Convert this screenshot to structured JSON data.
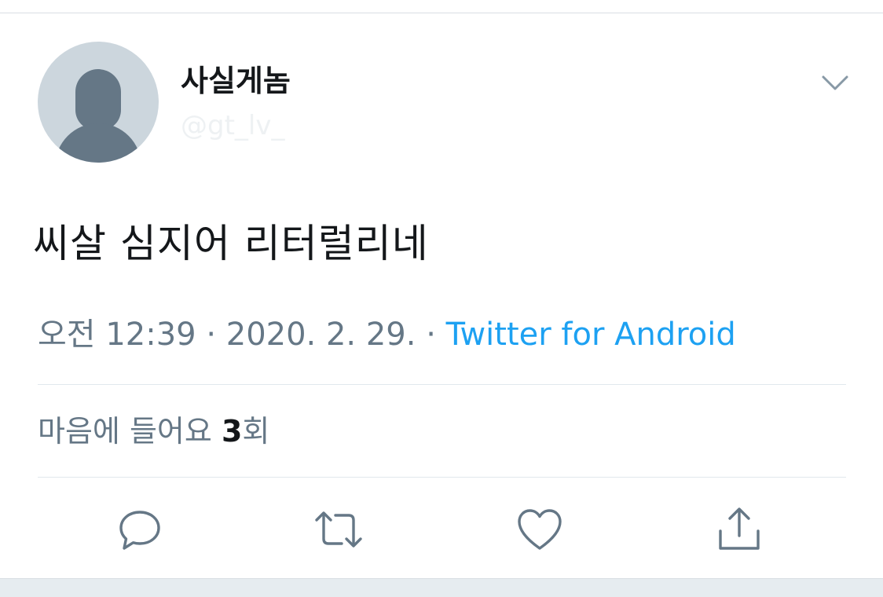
{
  "author": {
    "display_name": "사실게놈",
    "handle": "@gt_lv_"
  },
  "tweet": {
    "text": "씨살 심지어 리터럴리네",
    "time": "오전 12:39",
    "separator": "·",
    "date": "2020. 2. 29.",
    "source": "Twitter for Android"
  },
  "likes": {
    "label": "마음에 들어요",
    "count": "3",
    "suffix": "회"
  },
  "icons": {
    "menu": "chevron-down-icon",
    "reply": "reply-icon",
    "retweet": "retweet-icon",
    "like": "heart-icon",
    "share": "share-icon"
  },
  "colors": {
    "link": "#1da1f2",
    "secondary_text": "#657786",
    "primary_text": "#14171a",
    "avatar_bg": "#ccd6dd",
    "avatar_figure": "#657786"
  }
}
